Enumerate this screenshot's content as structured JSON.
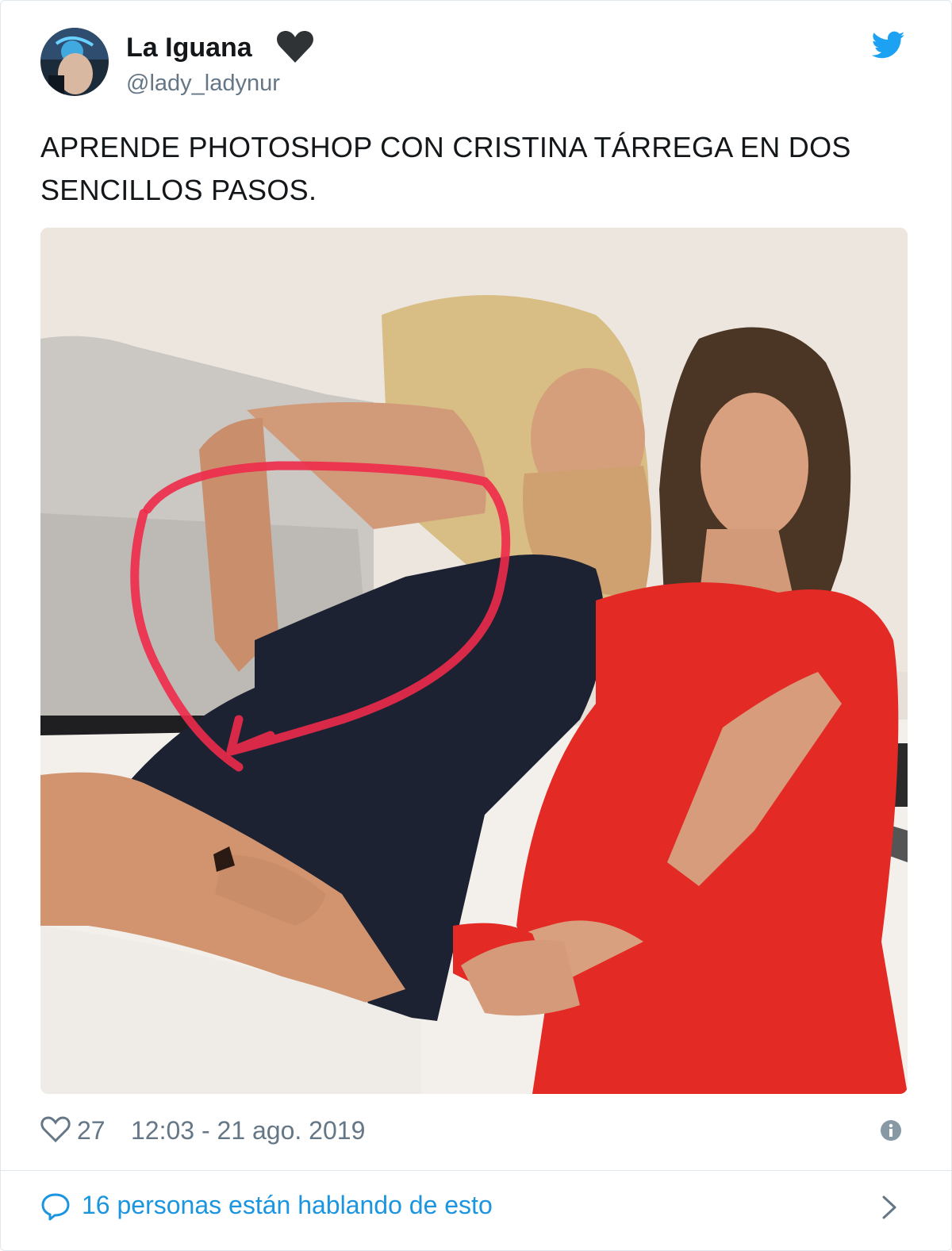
{
  "author": {
    "display_name": "La Iguana",
    "handle": "@lady_ladynur",
    "avatar_icon": "avatar-photo",
    "name_emoji_icon": "black-heart-icon"
  },
  "brand": {
    "icon": "twitter-bird-icon",
    "color": "#1da1f2"
  },
  "tweet": {
    "text": "APRENDE PHOTOSHOP CON CRISTINA TÁRREGA EN DOS SENCILLOS PASOS."
  },
  "footer": {
    "like_icon": "heart-outline-icon",
    "likes": "27",
    "timestamp": "12:03 - 21 ago. 2019",
    "info_icon": "info-icon"
  },
  "conversation": {
    "icon": "speech-bubble-icon",
    "text": "16 personas están hablando de esto",
    "chevron_icon": "chevron-right-icon"
  },
  "colors": {
    "text_primary": "#14171a",
    "text_secondary": "#657786",
    "link": "#1b95e0",
    "border": "#e1e8ed",
    "annotation_red": "#ee2a4a"
  }
}
